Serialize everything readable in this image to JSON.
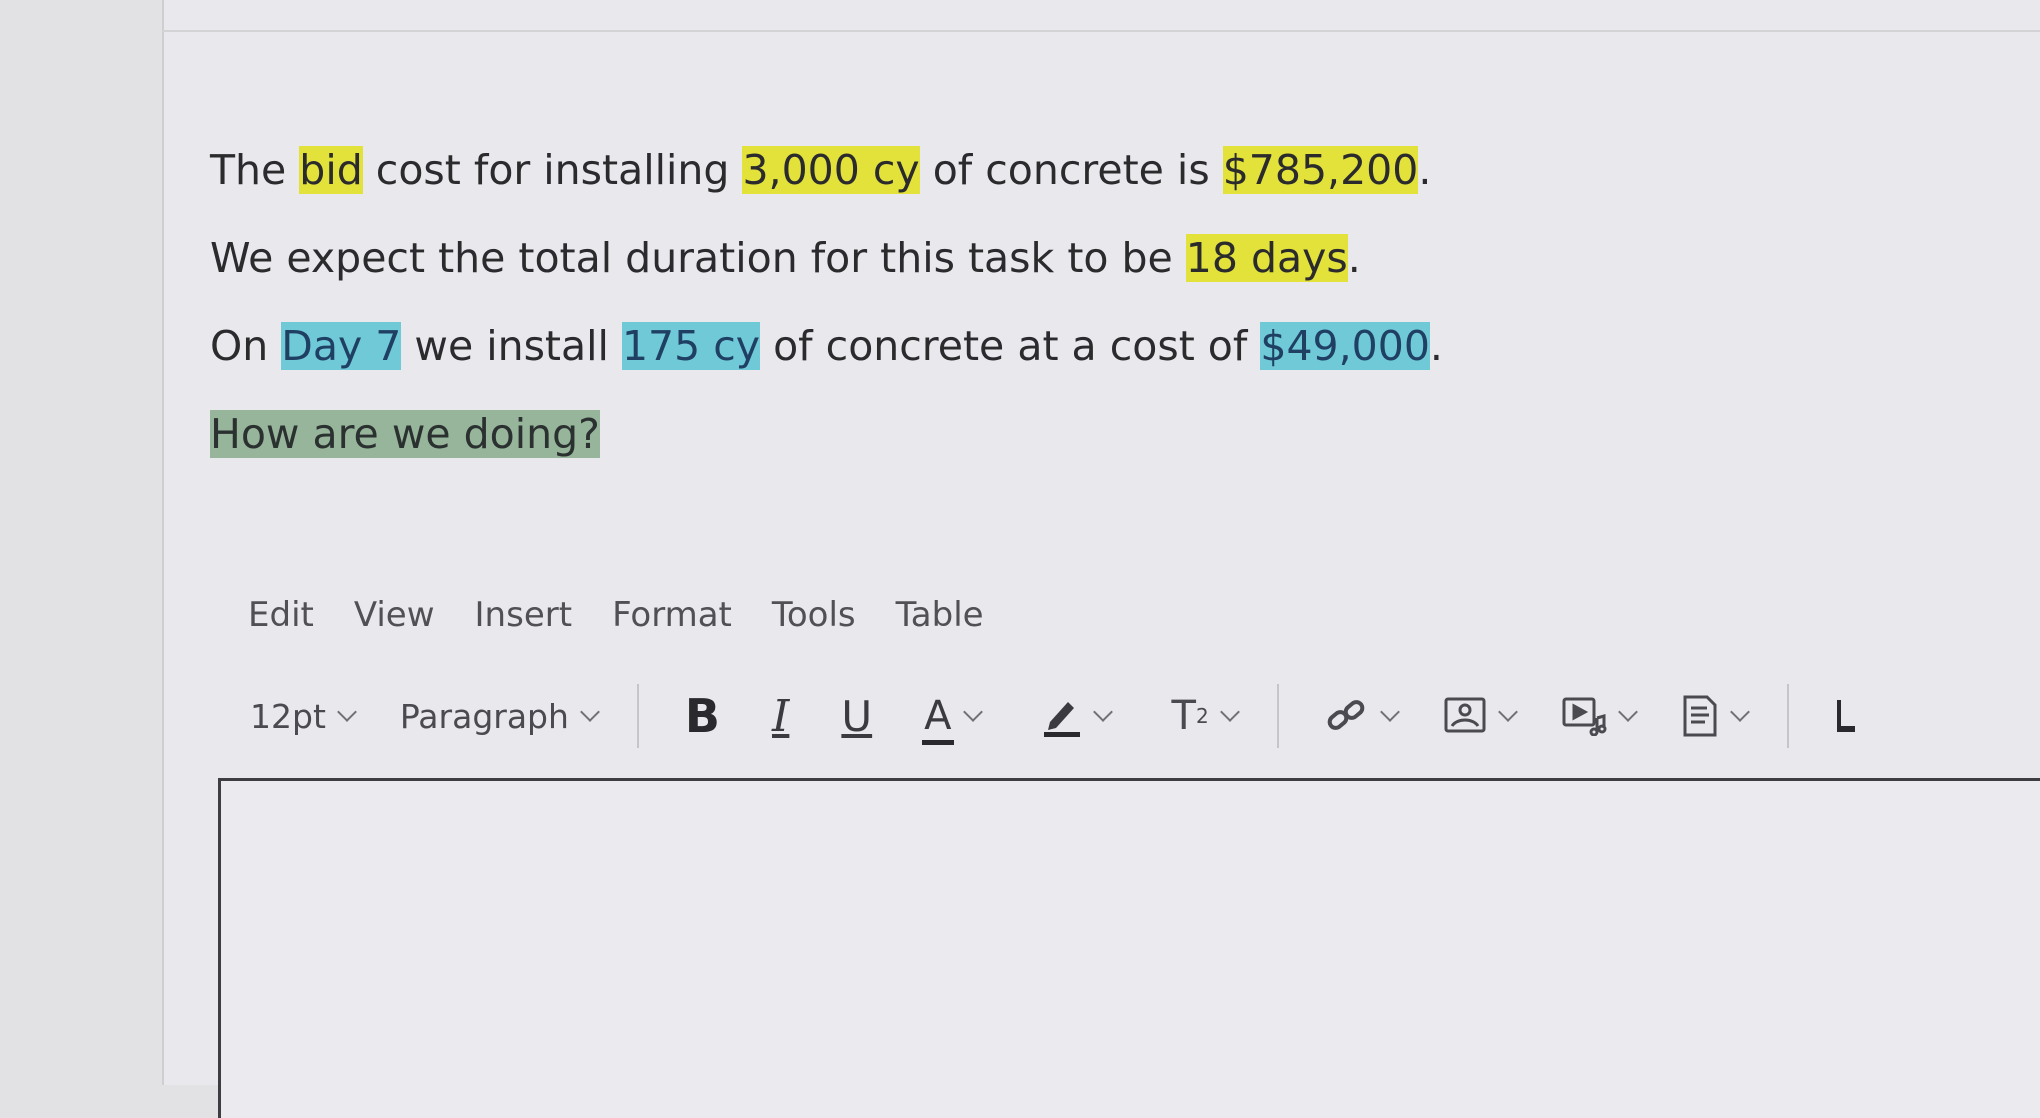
{
  "question": {
    "line1": {
      "t1": "The ",
      "bid": "bid",
      "t2": " cost for installing ",
      "qty": "3,000 cy",
      "t3": " of concrete is ",
      "cost": "$785,200",
      "t4": "."
    },
    "line2": {
      "t1": "We expect the total duration for this task to be ",
      "duration": "18 days",
      "t2": "."
    },
    "line3": {
      "t1": "On ",
      "day": "Day 7",
      "t2": " we install ",
      "qty": "175 cy",
      "t3": " of concrete at a cost of ",
      "cost": "$49,000",
      "t4": "."
    },
    "line4": "How are we doing?"
  },
  "menubar": {
    "items": [
      "Edit",
      "View",
      "Insert",
      "Format",
      "Tools",
      "Table"
    ]
  },
  "toolbar": {
    "font_size": "12pt",
    "block_format": "Paragraph",
    "bold": "B",
    "italic": "I",
    "underline": "U",
    "text_color": "A",
    "superscript": "T",
    "superscript_exp": "2",
    "icons": [
      "chevron-down-icon",
      "pencil-highlight-icon",
      "link-icon",
      "image-icon",
      "media-icon",
      "document-icon",
      "accessibility-icon"
    ]
  },
  "colors": {
    "highlight_yellow": "#e2e23a",
    "highlight_cyan": "#6fc9d6",
    "highlight_green": "#96b59a"
  }
}
